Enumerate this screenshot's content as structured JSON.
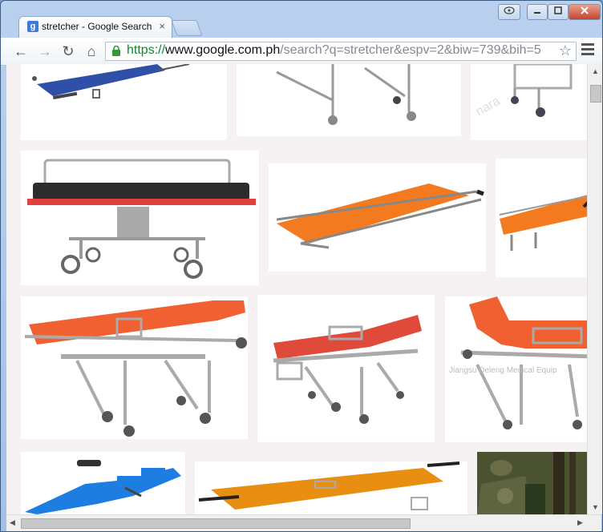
{
  "browser": {
    "tab_title": "stretcher - Google Search",
    "tab_favicon": "g",
    "close_tab": "×",
    "url_scheme": "https://",
    "url_host": "www.google.com.ph",
    "url_path": "/search?q=stretcher&espv=2&biw=739&bih=5",
    "star": "☆",
    "back": "←",
    "forward": "→",
    "reload": "↻",
    "home": "⌂"
  },
  "images": [
    {
      "name": "image-result-blue-folding-stretcher",
      "label": "blue folding stretcher"
    },
    {
      "name": "image-result-stretcher-trolley-top",
      "label": "stretcher trolley"
    },
    {
      "name": "image-result-stretcher-frame-top-right",
      "label": "stretcher frame"
    },
    {
      "name": "image-result-hospital-stretcher-black-mattress",
      "label": "hospital stretcher"
    },
    {
      "name": "image-result-orange-folding-stretcher",
      "label": "orange folding stretcher"
    },
    {
      "name": "image-result-orange-stretcher-partial",
      "label": "orange stretcher"
    },
    {
      "name": "image-result-ambulance-stretcher-orange-large",
      "label": "ambulance stretcher"
    },
    {
      "name": "image-result-ambulance-stretcher-red",
      "label": "ambulance stretcher red"
    },
    {
      "name": "image-result-ambulance-stretcher-watermark",
      "label": "ambulance stretcher"
    },
    {
      "name": "image-result-blue-ambulance-stretcher",
      "label": "blue stretcher"
    },
    {
      "name": "image-result-orange-pole-stretcher",
      "label": "pole stretcher"
    },
    {
      "name": "image-result-soldier-forest",
      "label": "soldier in forest"
    }
  ],
  "watermark_text": "Jiangsu Deleng Medical Equip"
}
